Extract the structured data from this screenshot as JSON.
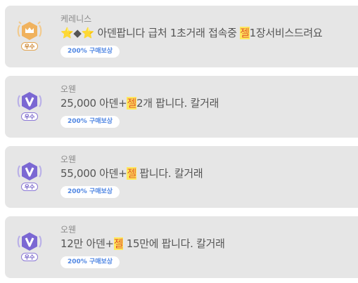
{
  "listings": [
    {
      "seller": "케레니스",
      "badge": "gold-crown-badge",
      "grade": "우수",
      "title_before": "⭐◆⭐ 아덴팝니다 급처 1초거래 접속중 ",
      "title_highlight": "젤",
      "title_after": "1장서비스드려요",
      "reward": "200% 구매보상"
    },
    {
      "seller": "오웬",
      "badge": "purple-v-badge",
      "grade": "우수",
      "title_before": "25,000 아덴+",
      "title_highlight": "젤",
      "title_after": "2개 팝니다. 칼거래",
      "reward": "200% 구매보상"
    },
    {
      "seller": "오웬",
      "badge": "purple-v-badge",
      "grade": "우수",
      "title_before": "55,000 아덴+",
      "title_highlight": "젤",
      "title_after": " 팝니다. 칼거래",
      "reward": "200% 구매보상"
    },
    {
      "seller": "오웬",
      "badge": "purple-v-badge",
      "grade": "우수",
      "title_before": "12만 아덴+",
      "title_highlight": "젤",
      "title_after": " 15만에 팝니다. 칼거래",
      "reward": "200% 구매보상"
    }
  ],
  "colors": {
    "card_bg": "#e6e6e6",
    "highlight_bg": "#ffe95c",
    "highlight_text": "#e2552a",
    "reward_text": "#4f86e3",
    "gold": "#f0b25e",
    "purple": "#7b68d3"
  }
}
